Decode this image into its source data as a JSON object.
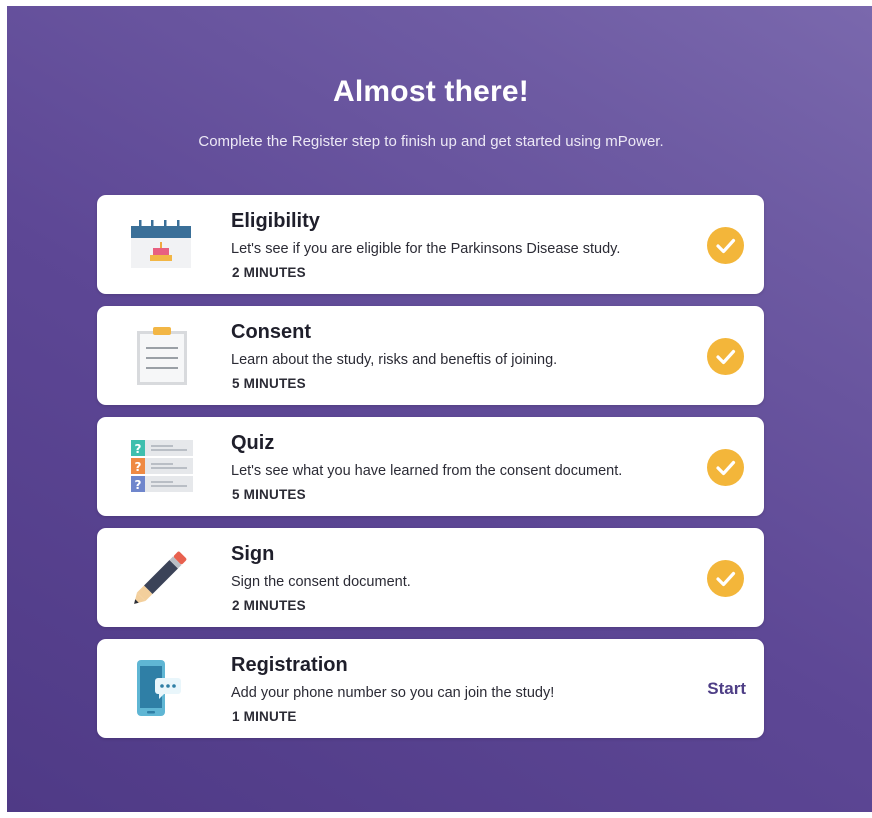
{
  "header": {
    "title": "Almost there!",
    "subtitle": "Complete the Register step to finish up and get started using mPower."
  },
  "colors": {
    "background": "#5a4592",
    "card": "#ffffff",
    "check": "#f3b63a",
    "accent": "#4e3e86"
  },
  "steps": [
    {
      "title": "Eligibility",
      "description": "Let's see if you are eligible for the Parkinsons Disease study.",
      "duration": "2 MINUTES",
      "icon": "calendar-icon",
      "status": "complete"
    },
    {
      "title": "Consent",
      "description": "Learn about the study, risks and beneftis of joining.",
      "duration": "5 MINUTES",
      "icon": "clipboard-icon",
      "status": "complete"
    },
    {
      "title": "Quiz",
      "description": "Let's see what you have learned from the consent document.",
      "duration": "5 MINUTES",
      "icon": "quiz-icon",
      "status": "complete"
    },
    {
      "title": "Sign",
      "description": "Sign the consent document.",
      "duration": "2 MINUTES",
      "icon": "pencil-icon",
      "status": "complete"
    },
    {
      "title": "Registration",
      "description": "Add your phone number so you can join the study!",
      "duration": "1 MINUTE",
      "icon": "phone-message-icon",
      "status": "pending",
      "action_label": "Start"
    }
  ]
}
